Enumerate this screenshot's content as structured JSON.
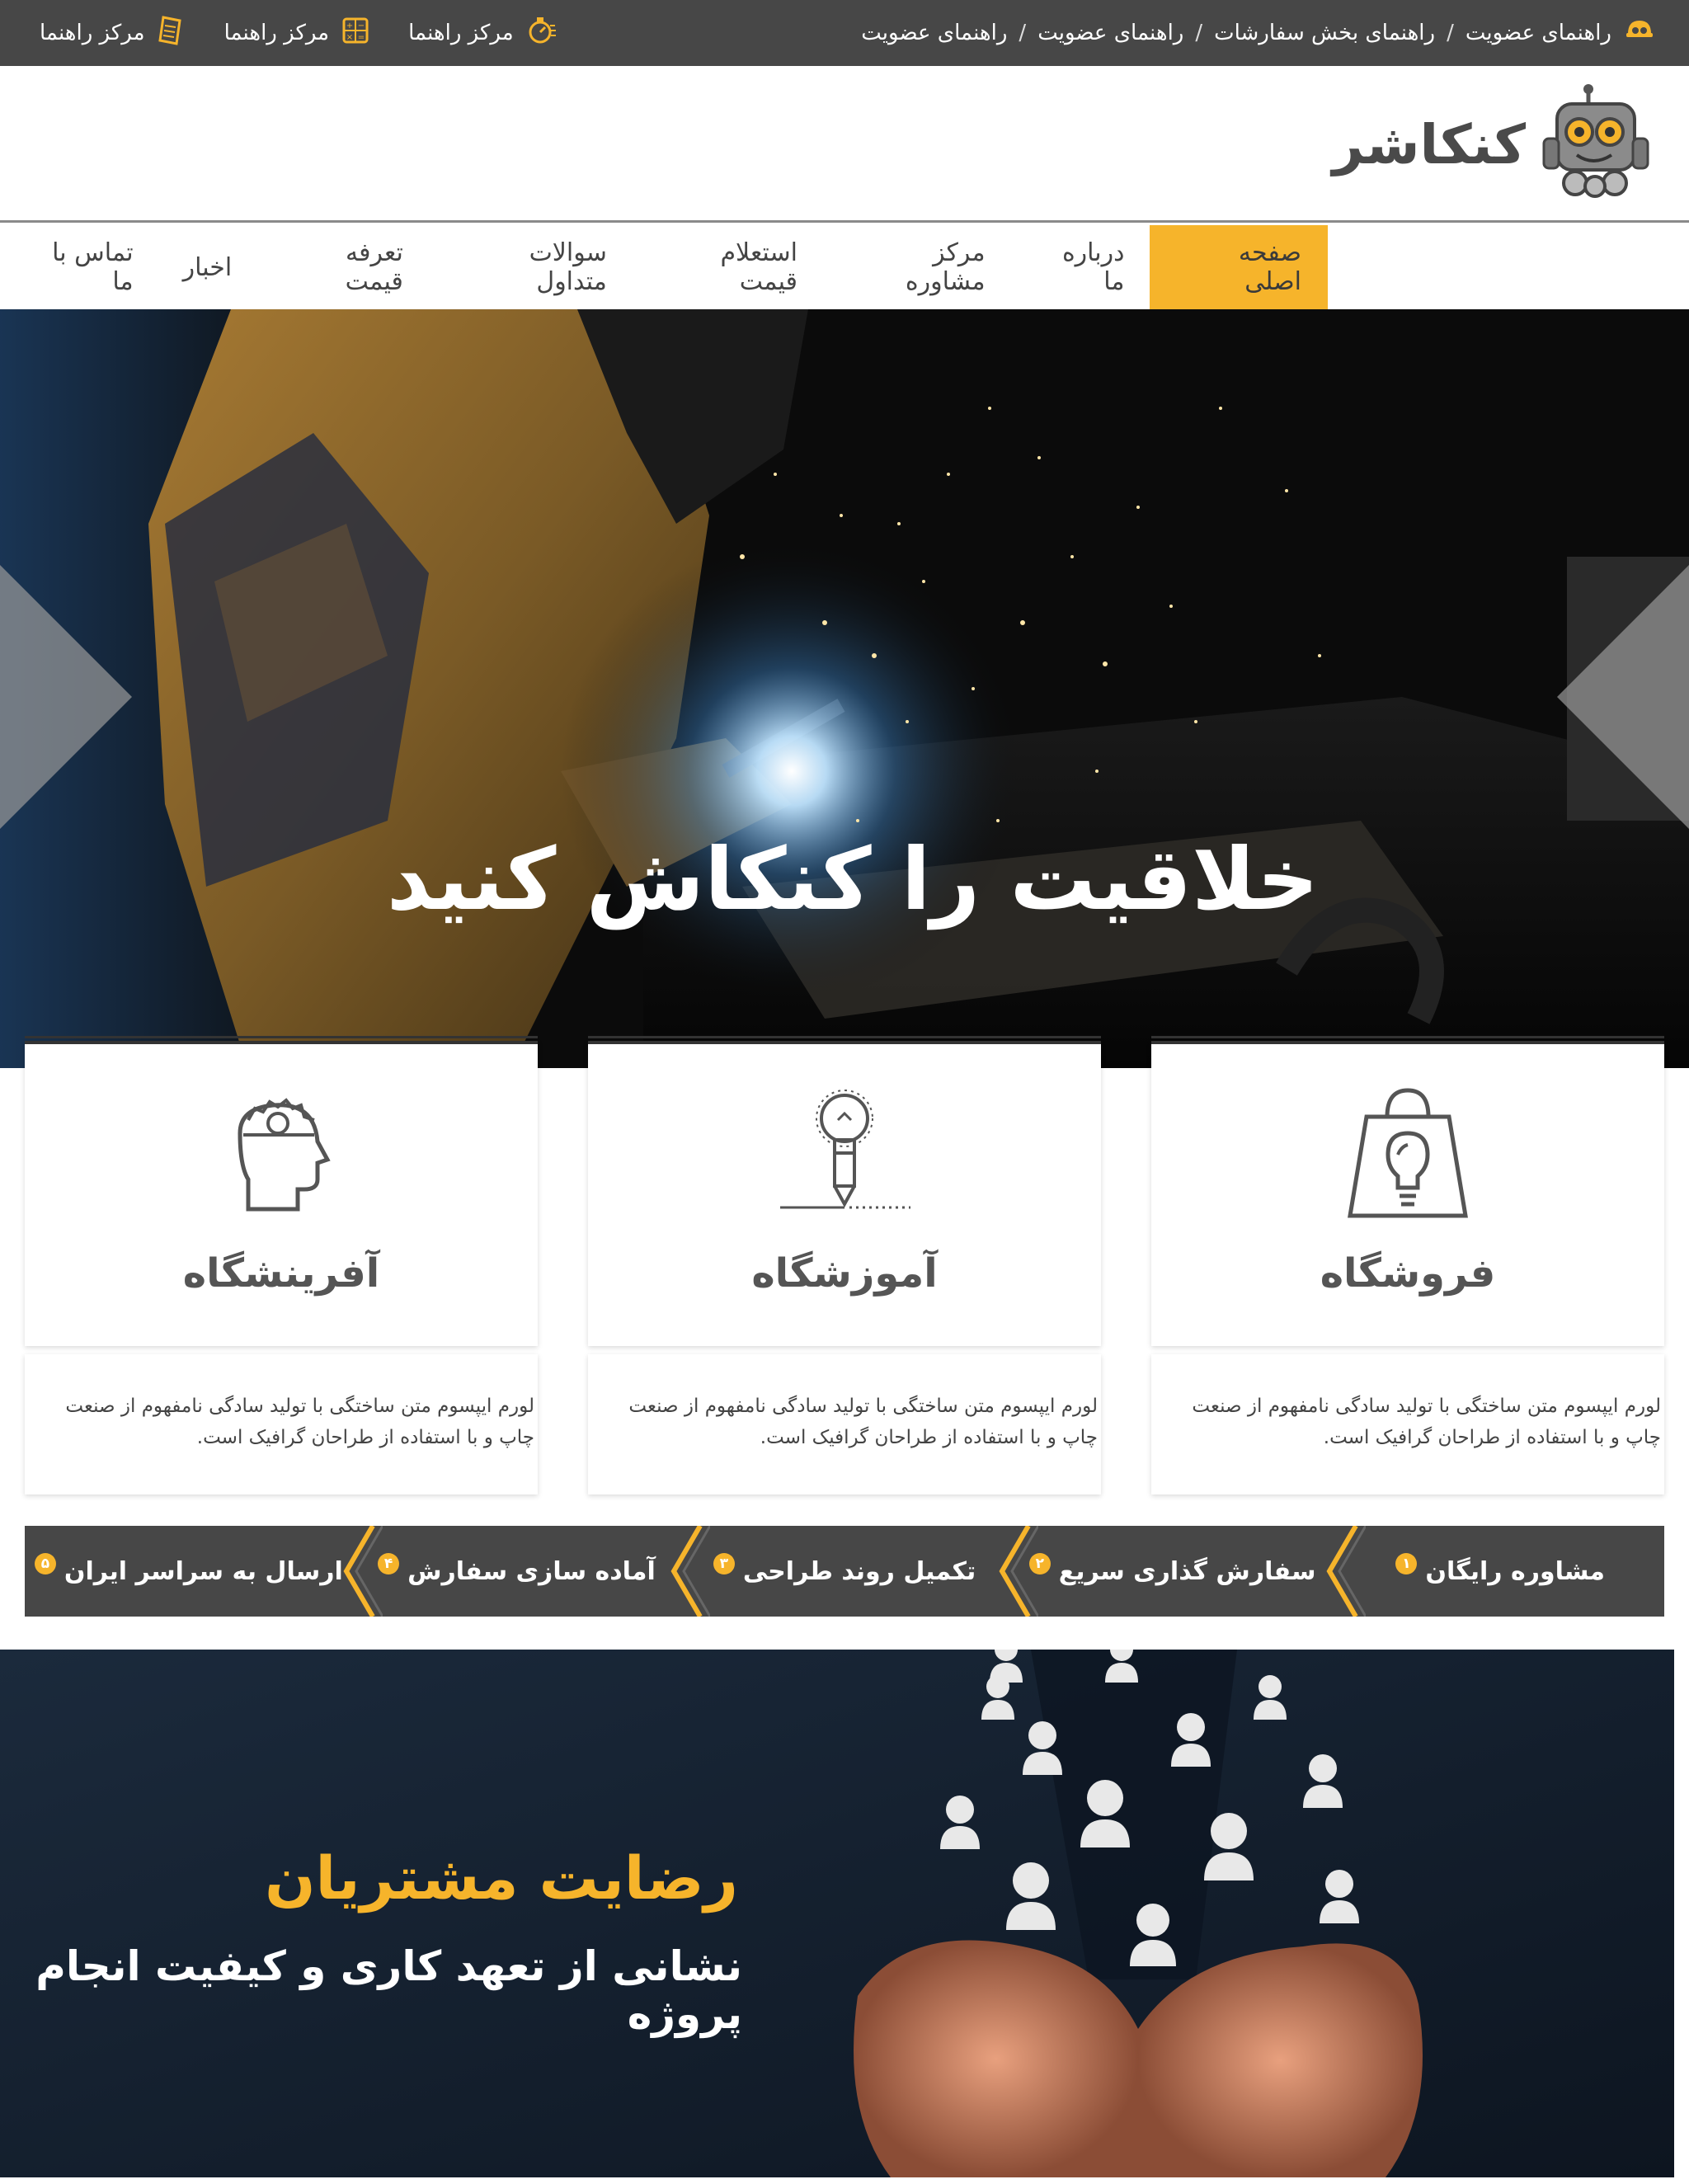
{
  "topbar": {
    "breadcrumb": [
      "راهنمای عضویت",
      "راهنمای بخش سفارشات",
      "راهنمای عضویت",
      "راهنمای عضویت"
    ],
    "separator": "/",
    "help_links": [
      {
        "label": "مرکز راهنما",
        "icon": "stopwatch-icon"
      },
      {
        "label": "مرکز راهنما",
        "icon": "calculator-icon"
      },
      {
        "label": "مرکز راهنما",
        "icon": "document-icon"
      }
    ]
  },
  "header": {
    "logo_text": "کنکاشر"
  },
  "nav": {
    "items": [
      {
        "label": "صفحه اصلی",
        "active": true
      },
      {
        "label": "درباره ما"
      },
      {
        "label": "مرکز مشاوره"
      },
      {
        "label": "استعلام قیمت"
      },
      {
        "label": "سوالات متداول"
      },
      {
        "label": "تعرفه قیمت"
      },
      {
        "label": "اخبار"
      },
      {
        "label": "تماس با ما"
      }
    ]
  },
  "hero": {
    "title": "خلاقیت را کنکاش کنید"
  },
  "cards": [
    {
      "title": "فروشگاه",
      "icon": "shopping-bag-bulb-icon",
      "desc": "لورم ایپسوم متن ساختگی با تولید سادگی نامفهوم از صنعت چاپ و با استفاده از طراحان گرافیک است."
    },
    {
      "title": "آموزشگاه",
      "icon": "lightbulb-pencil-icon",
      "desc": "لورم ایپسوم متن ساختگی با تولید سادگی نامفهوم از صنعت چاپ و با استفاده از طراحان گرافیک است."
    },
    {
      "title": "آفرینشگاه",
      "icon": "head-gear-icon",
      "desc": "لورم ایپسوم متن ساختگی با تولید سادگی نامفهوم از صنعت چاپ و با استفاده از طراحان گرافیک است."
    }
  ],
  "steps": [
    {
      "num": "۱",
      "label": "مشاوره رایگان"
    },
    {
      "num": "۲",
      "label": "سفارش گذاری سریع"
    },
    {
      "num": "۳",
      "label": "تکمیل روند طراحی"
    },
    {
      "num": "۴",
      "label": "آماده سازی سفارش"
    },
    {
      "num": "۵",
      "label": "ارسال به سراسر ایران"
    }
  ],
  "satisfaction": {
    "title": "رضایت مشتریان",
    "subtitle": "نشانی از تعهد کاری و کیفیت انجام پروژه"
  },
  "colors": {
    "accent": "#f6b42b",
    "dark_bar": "#474747",
    "white": "#ffffff"
  }
}
